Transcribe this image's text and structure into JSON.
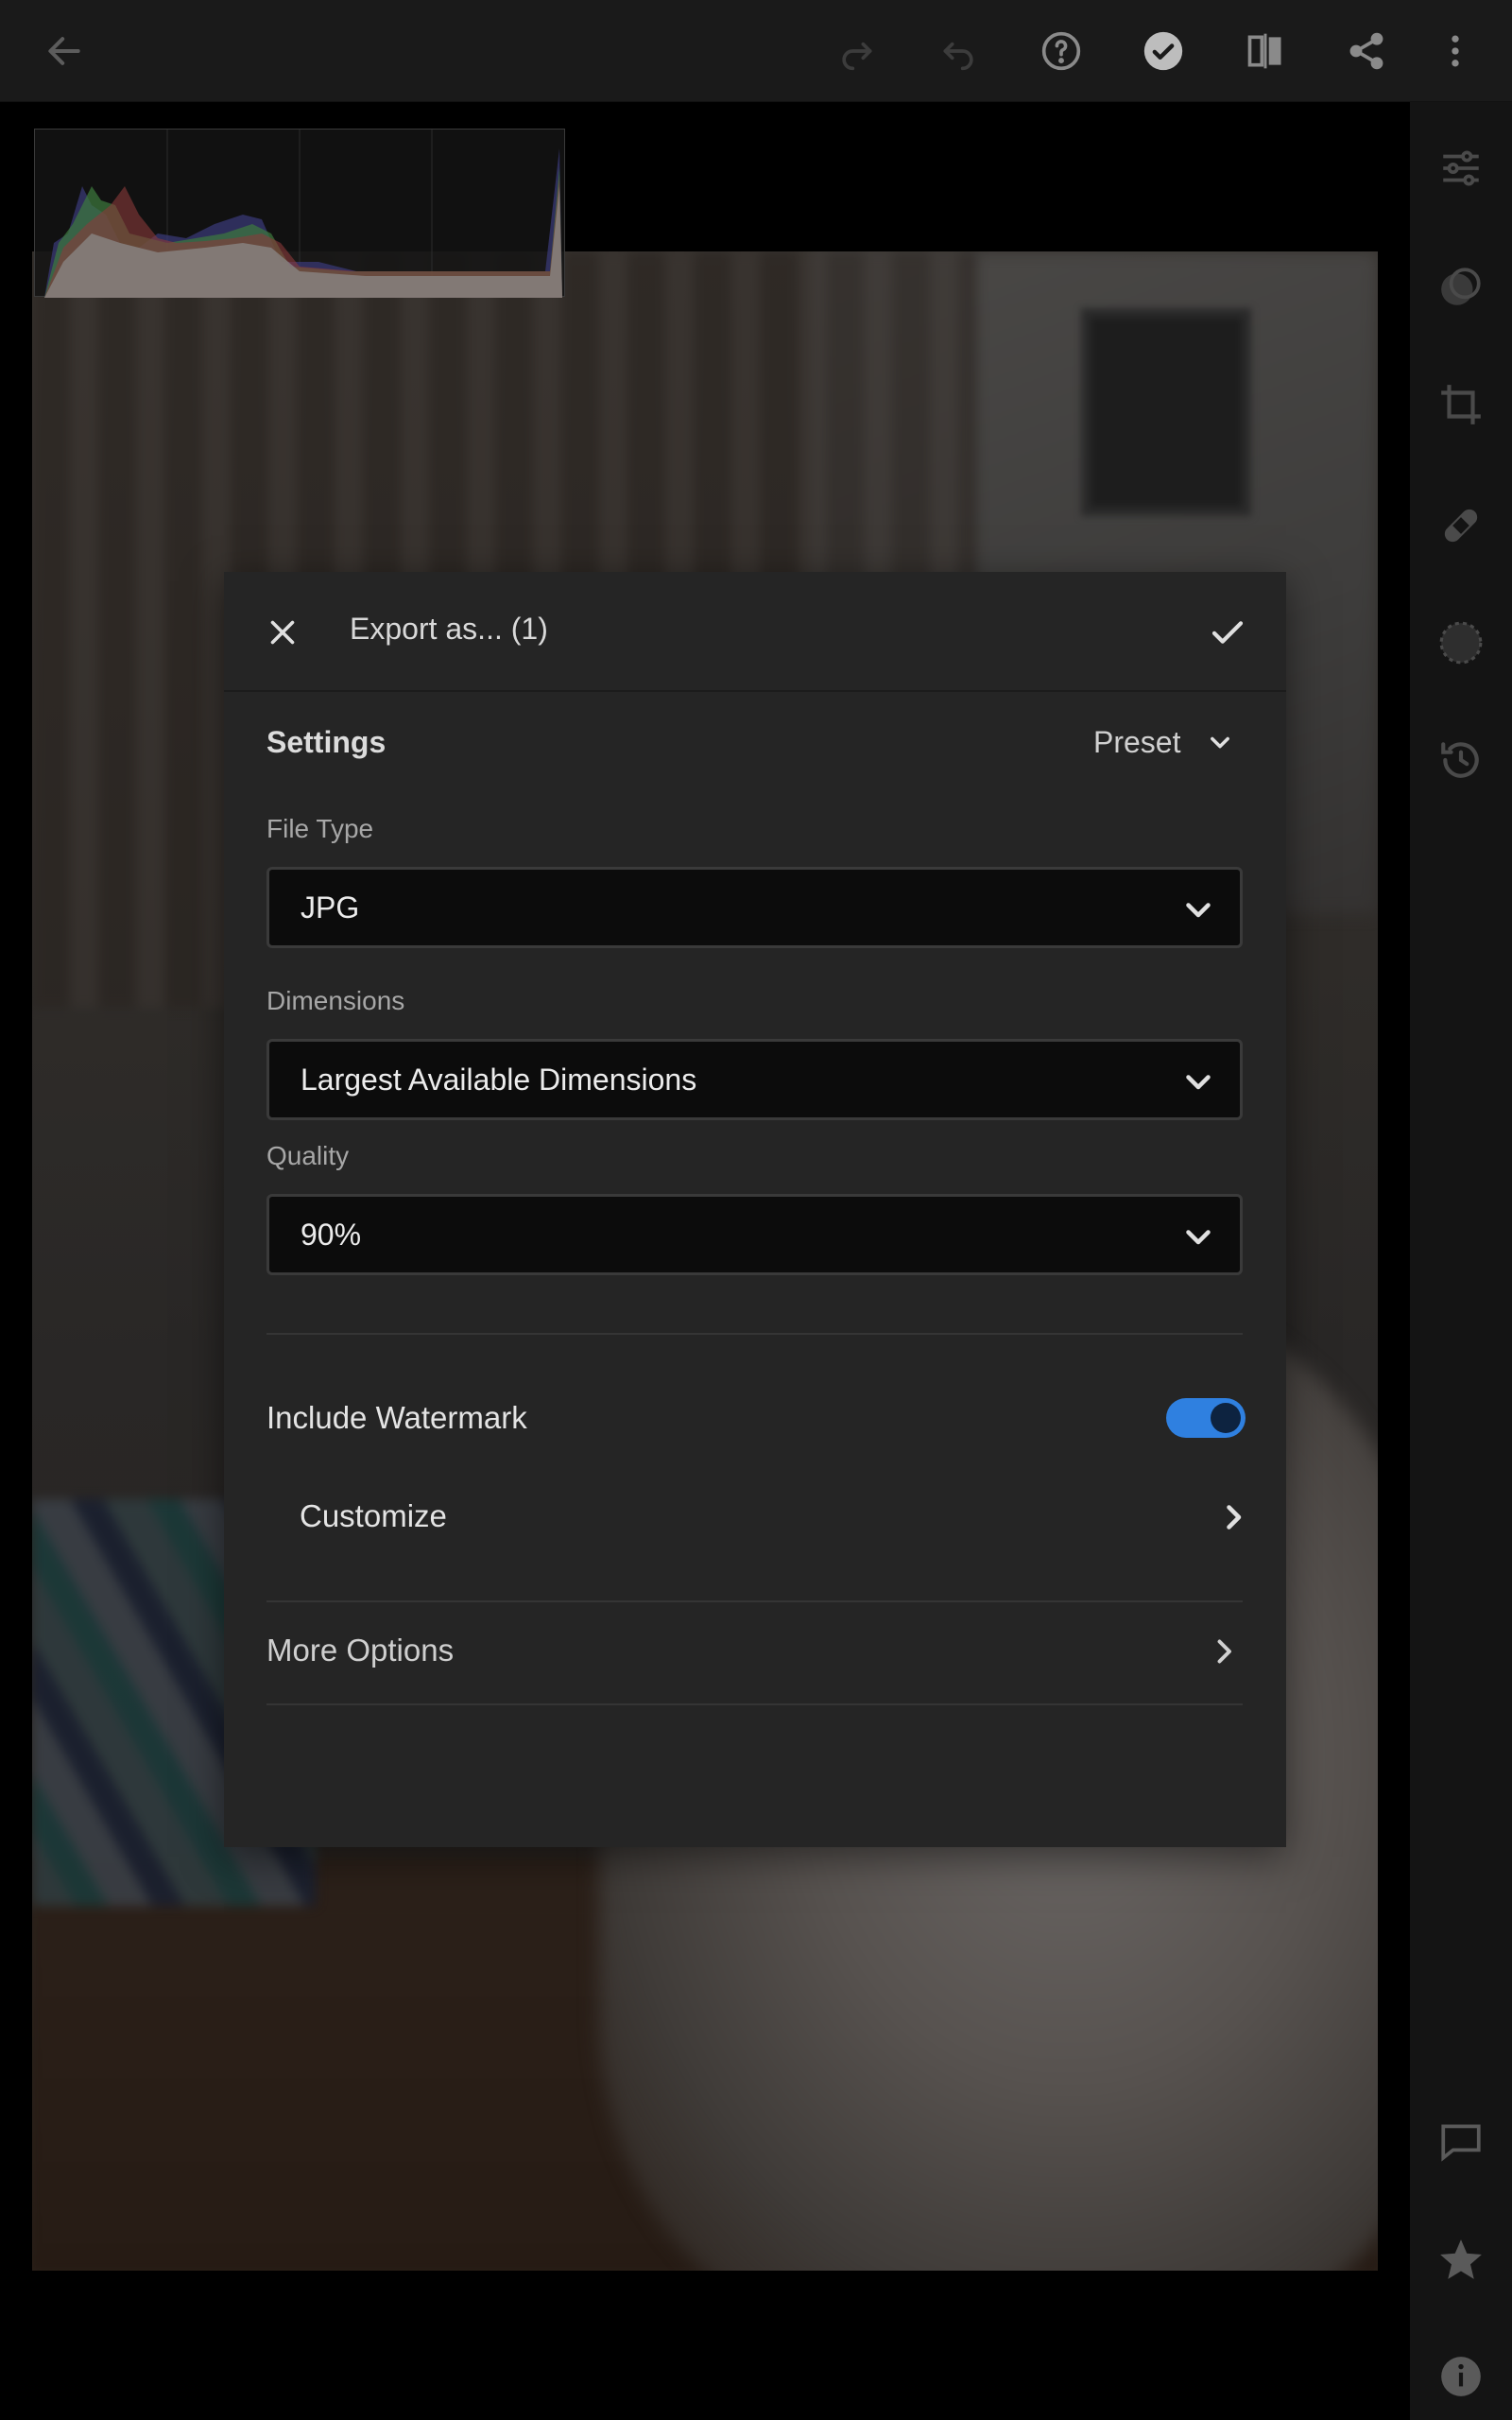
{
  "toolbar": {
    "back_icon": "arrow-left-icon",
    "redo_icon": "redo-icon",
    "undo_icon": "undo-icon",
    "help_icon": "help-icon",
    "done_icon": "check-circle-icon",
    "compare_icon": "compare-icon",
    "share_icon": "share-icon",
    "more_icon": "more-vertical-icon"
  },
  "right_panel": {
    "icons": [
      "sliders-icon",
      "masking-icon",
      "crop-icon",
      "healing-icon",
      "presets-icon",
      "history-icon",
      "comment-icon",
      "star-icon",
      "info-icon"
    ]
  },
  "dialog": {
    "title": "Export as... (1)",
    "settings_label": "Settings",
    "preset_label": "Preset",
    "file_type": {
      "label": "File Type",
      "value": "JPG"
    },
    "dimensions": {
      "label": "Dimensions",
      "value": "Largest Available Dimensions"
    },
    "quality": {
      "label": "Quality",
      "value": "90%"
    },
    "watermark": {
      "label": "Include Watermark",
      "enabled": true
    },
    "customize_label": "Customize",
    "more_options_label": "More Options"
  },
  "colors": {
    "accent": "#2f80e0",
    "dialog_bg": "#252525",
    "select_bg": "#0c0c0c"
  }
}
